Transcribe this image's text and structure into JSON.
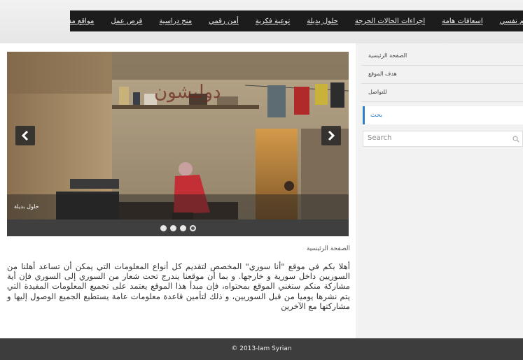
{
  "nav": {
    "items": [
      "دعم نفسي",
      "اسعافات هامة",
      "اجراءات الحالات الحرجة",
      "حلول بديلة",
      "توعية فكرية",
      "أمن رقمي",
      "منح دراسية",
      "فرص عمل",
      "مواقع مفيدة"
    ]
  },
  "slider": {
    "caption": "حلول بديلة",
    "prev_icon": "chevron-left-icon",
    "next_icon": "chevron-right-icon",
    "dots": 4,
    "active_dot": 4
  },
  "sidebar": {
    "links": [
      "الصفحة الرئيسية",
      "هدف الموقع",
      "للتواصل"
    ],
    "search_heading": "بحث",
    "search_placeholder": "Search"
  },
  "main": {
    "breadcrumb": "الصفحة الرئيسية",
    "intro": "أهلا بكم في موقع \"أنا سوري\" المخصص لتقديم كل أنواع المعلومات التي يمكن أن تساعد أهلنا من السوريين داخل سورية و خارجها. و بما أن موقعنا يندرج تحت شعار من السوري إلى السوري فإن أية مشاركة منكم ستغني الموقع بمحتواه، فإن مبدأ هذا الموقع يعتمد على تجميع المعلومات المفيدة التي يتم نشرها يوميا من قبل السوريين، و ذلك لتأمين قاعدة معلومات عامة يستطيع الجميع الوصول إليها و مشاركتها مع الآخرين"
  },
  "footer": {
    "text": "© 2013-Iam Syrian"
  },
  "colors": {
    "navbar": "#1c1c1c",
    "accent": "#2e7fc8",
    "footer": "#3d3d3d"
  }
}
